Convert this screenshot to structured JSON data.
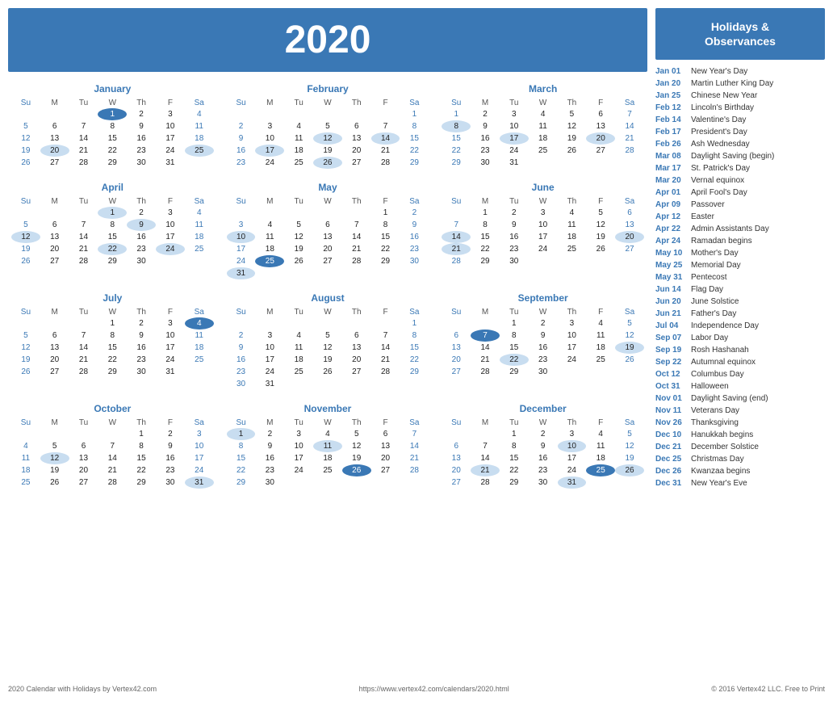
{
  "header": {
    "year": "2020",
    "bg_color": "#3a78b5"
  },
  "holidays_panel": {
    "title": "Holidays &\nObservances",
    "items": [
      {
        "date": "Jan 01",
        "name": "New Year's Day"
      },
      {
        "date": "Jan 20",
        "name": "Martin Luther King Day"
      },
      {
        "date": "Jan 25",
        "name": "Chinese New Year"
      },
      {
        "date": "Feb 12",
        "name": "Lincoln's Birthday"
      },
      {
        "date": "Feb 14",
        "name": "Valentine's Day"
      },
      {
        "date": "Feb 17",
        "name": "President's Day"
      },
      {
        "date": "Feb 26",
        "name": "Ash Wednesday"
      },
      {
        "date": "Mar 08",
        "name": "Daylight Saving (begin)"
      },
      {
        "date": "Mar 17",
        "name": "St. Patrick's Day"
      },
      {
        "date": "Mar 20",
        "name": "Vernal equinox"
      },
      {
        "date": "Apr 01",
        "name": "April Fool's Day"
      },
      {
        "date": "Apr 09",
        "name": "Passover"
      },
      {
        "date": "Apr 12",
        "name": "Easter"
      },
      {
        "date": "Apr 22",
        "name": "Admin Assistants Day"
      },
      {
        "date": "Apr 24",
        "name": "Ramadan begins"
      },
      {
        "date": "May 10",
        "name": "Mother's Day"
      },
      {
        "date": "May 25",
        "name": "Memorial Day"
      },
      {
        "date": "May 31",
        "name": "Pentecost"
      },
      {
        "date": "Jun 14",
        "name": "Flag Day"
      },
      {
        "date": "Jun 20",
        "name": "June Solstice"
      },
      {
        "date": "Jun 21",
        "name": "Father's Day"
      },
      {
        "date": "Jul 04",
        "name": "Independence Day"
      },
      {
        "date": "Sep 07",
        "name": "Labor Day"
      },
      {
        "date": "Sep 19",
        "name": "Rosh Hashanah"
      },
      {
        "date": "Sep 22",
        "name": "Autumnal equinox"
      },
      {
        "date": "Oct 12",
        "name": "Columbus Day"
      },
      {
        "date": "Oct 31",
        "name": "Halloween"
      },
      {
        "date": "Nov 01",
        "name": "Daylight Saving (end)"
      },
      {
        "date": "Nov 11",
        "name": "Veterans Day"
      },
      {
        "date": "Nov 26",
        "name": "Thanksgiving"
      },
      {
        "date": "Dec 10",
        "name": "Hanukkah begins"
      },
      {
        "date": "Dec 21",
        "name": "December Solstice"
      },
      {
        "date": "Dec 25",
        "name": "Christmas Day"
      },
      {
        "date": "Dec 26",
        "name": "Kwanzaa begins"
      },
      {
        "date": "Dec 31",
        "name": "New Year's Eve"
      }
    ]
  },
  "months": [
    {
      "name": "January",
      "weeks": [
        [
          null,
          null,
          null,
          "1",
          "2",
          "3",
          "4"
        ],
        [
          "5",
          "6",
          "7",
          "8",
          "9",
          "10",
          "11"
        ],
        [
          "12",
          "13",
          "14",
          "15",
          "16",
          "17",
          "18"
        ],
        [
          "19",
          "20",
          "21",
          "22",
          "23",
          "24",
          "25"
        ],
        [
          "26",
          "27",
          "28",
          "29",
          "30",
          "31",
          null
        ]
      ],
      "holidays": [
        "1"
      ],
      "highlighted": [
        "20",
        "25"
      ]
    },
    {
      "name": "February",
      "weeks": [
        [
          null,
          null,
          null,
          null,
          null,
          null,
          "1"
        ],
        [
          "2",
          "3",
          "4",
          "5",
          "6",
          "7",
          "8"
        ],
        [
          "9",
          "10",
          "11",
          "12",
          "13",
          "14",
          "15"
        ],
        [
          "16",
          "17",
          "18",
          "19",
          "20",
          "21",
          "22"
        ],
        [
          "23",
          "24",
          "25",
          "26",
          "27",
          "28",
          "29"
        ]
      ],
      "holidays": [],
      "highlighted": [
        "12",
        "14",
        "17",
        "26"
      ]
    },
    {
      "name": "March",
      "weeks": [
        [
          "1",
          "2",
          "3",
          "4",
          "5",
          "6",
          "7"
        ],
        [
          "8",
          "9",
          "10",
          "11",
          "12",
          "13",
          "14"
        ],
        [
          "15",
          "16",
          "17",
          "18",
          "19",
          "20",
          "21"
        ],
        [
          "22",
          "23",
          "24",
          "25",
          "26",
          "27",
          "28"
        ],
        [
          "29",
          "30",
          "31",
          null,
          null,
          null,
          null
        ]
      ],
      "holidays": [],
      "highlighted": [
        "8",
        "17",
        "20"
      ]
    },
    {
      "name": "April",
      "weeks": [
        [
          null,
          null,
          null,
          "1",
          "2",
          "3",
          "4"
        ],
        [
          "5",
          "6",
          "7",
          "8",
          "9",
          "10",
          "11"
        ],
        [
          "12",
          "13",
          "14",
          "15",
          "16",
          "17",
          "18"
        ],
        [
          "19",
          "20",
          "21",
          "22",
          "23",
          "24",
          "25"
        ],
        [
          "26",
          "27",
          "28",
          "29",
          "30",
          null,
          null
        ]
      ],
      "holidays": [],
      "highlighted": [
        "1",
        "9",
        "12",
        "22",
        "24"
      ]
    },
    {
      "name": "May",
      "weeks": [
        [
          null,
          null,
          null,
          null,
          null,
          "1",
          "2"
        ],
        [
          "3",
          "4",
          "5",
          "6",
          "7",
          "8",
          "9"
        ],
        [
          "10",
          "11",
          "12",
          "13",
          "14",
          "15",
          "16"
        ],
        [
          "17",
          "18",
          "19",
          "20",
          "21",
          "22",
          "23"
        ],
        [
          "24",
          "25",
          "26",
          "27",
          "28",
          "29",
          "30"
        ],
        [
          "31",
          null,
          null,
          null,
          null,
          null,
          null
        ]
      ],
      "holidays": [
        "25"
      ],
      "highlighted": [
        "10",
        "31"
      ]
    },
    {
      "name": "June",
      "weeks": [
        [
          null,
          "1",
          "2",
          "3",
          "4",
          "5",
          "6"
        ],
        [
          "7",
          "8",
          "9",
          "10",
          "11",
          "12",
          "13"
        ],
        [
          "14",
          "15",
          "16",
          "17",
          "18",
          "19",
          "20"
        ],
        [
          "21",
          "22",
          "23",
          "24",
          "25",
          "26",
          "27"
        ],
        [
          "28",
          "29",
          "30",
          null,
          null,
          null,
          null
        ]
      ],
      "holidays": [],
      "highlighted": [
        "14",
        "20",
        "21"
      ]
    },
    {
      "name": "July",
      "weeks": [
        [
          null,
          null,
          null,
          "1",
          "2",
          "3",
          "4"
        ],
        [
          "5",
          "6",
          "7",
          "8",
          "9",
          "10",
          "11"
        ],
        [
          "12",
          "13",
          "14",
          "15",
          "16",
          "17",
          "18"
        ],
        [
          "19",
          "20",
          "21",
          "22",
          "23",
          "24",
          "25"
        ],
        [
          "26",
          "27",
          "28",
          "29",
          "30",
          "31",
          null
        ]
      ],
      "holidays": [
        "4"
      ],
      "highlighted": []
    },
    {
      "name": "August",
      "weeks": [
        [
          null,
          null,
          null,
          null,
          null,
          null,
          "1"
        ],
        [
          "2",
          "3",
          "4",
          "5",
          "6",
          "7",
          "8"
        ],
        [
          "9",
          "10",
          "11",
          "12",
          "13",
          "14",
          "15"
        ],
        [
          "16",
          "17",
          "18",
          "19",
          "20",
          "21",
          "22"
        ],
        [
          "23",
          "24",
          "25",
          "26",
          "27",
          "28",
          "29"
        ],
        [
          "30",
          "31",
          null,
          null,
          null,
          null,
          null
        ]
      ],
      "holidays": [],
      "highlighted": []
    },
    {
      "name": "September",
      "weeks": [
        [
          null,
          null,
          "1",
          "2",
          "3",
          "4",
          "5"
        ],
        [
          "6",
          "7",
          "8",
          "9",
          "10",
          "11",
          "12"
        ],
        [
          "13",
          "14",
          "15",
          "16",
          "17",
          "18",
          "19"
        ],
        [
          "20",
          "21",
          "22",
          "23",
          "24",
          "25",
          "26"
        ],
        [
          "27",
          "28",
          "29",
          "30",
          null,
          null,
          null
        ]
      ],
      "holidays": [
        "7"
      ],
      "highlighted": [
        "7",
        "19",
        "22"
      ]
    },
    {
      "name": "October",
      "weeks": [
        [
          null,
          null,
          null,
          null,
          "1",
          "2",
          "3"
        ],
        [
          "4",
          "5",
          "6",
          "7",
          "8",
          "9",
          "10"
        ],
        [
          "11",
          "12",
          "13",
          "14",
          "15",
          "16",
          "17"
        ],
        [
          "18",
          "19",
          "20",
          "21",
          "22",
          "23",
          "24"
        ],
        [
          "25",
          "26",
          "27",
          "28",
          "29",
          "30",
          "31"
        ]
      ],
      "holidays": [],
      "highlighted": [
        "12",
        "31"
      ]
    },
    {
      "name": "November",
      "weeks": [
        [
          "1",
          "2",
          "3",
          "4",
          "5",
          "6",
          "7"
        ],
        [
          "8",
          "9",
          "10",
          "11",
          "12",
          "13",
          "14"
        ],
        [
          "15",
          "16",
          "17",
          "18",
          "19",
          "20",
          "21"
        ],
        [
          "22",
          "23",
          "24",
          "25",
          "26",
          "27",
          "28"
        ],
        [
          "29",
          "30",
          null,
          null,
          null,
          null,
          null
        ]
      ],
      "holidays": [
        "26"
      ],
      "highlighted": [
        "1",
        "11",
        "26"
      ]
    },
    {
      "name": "December",
      "weeks": [
        [
          null,
          null,
          "1",
          "2",
          "3",
          "4",
          "5"
        ],
        [
          "6",
          "7",
          "8",
          "9",
          "10",
          "11",
          "12"
        ],
        [
          "13",
          "14",
          "15",
          "16",
          "17",
          "18",
          "19"
        ],
        [
          "20",
          "21",
          "22",
          "23",
          "24",
          "25",
          "26"
        ],
        [
          "27",
          "28",
          "29",
          "30",
          "31",
          null,
          null
        ]
      ],
      "holidays": [
        "25"
      ],
      "highlighted": [
        "10",
        "21",
        "25",
        "26",
        "31"
      ]
    }
  ],
  "day_headers": [
    "Su",
    "M",
    "Tu",
    "W",
    "Th",
    "F",
    "Sa"
  ],
  "footer": {
    "left": "2020 Calendar with Holidays by Vertex42.com",
    "center": "https://www.vertex42.com/calendars/2020.html",
    "right": "© 2016 Vertex42 LLC. Free to Print"
  }
}
